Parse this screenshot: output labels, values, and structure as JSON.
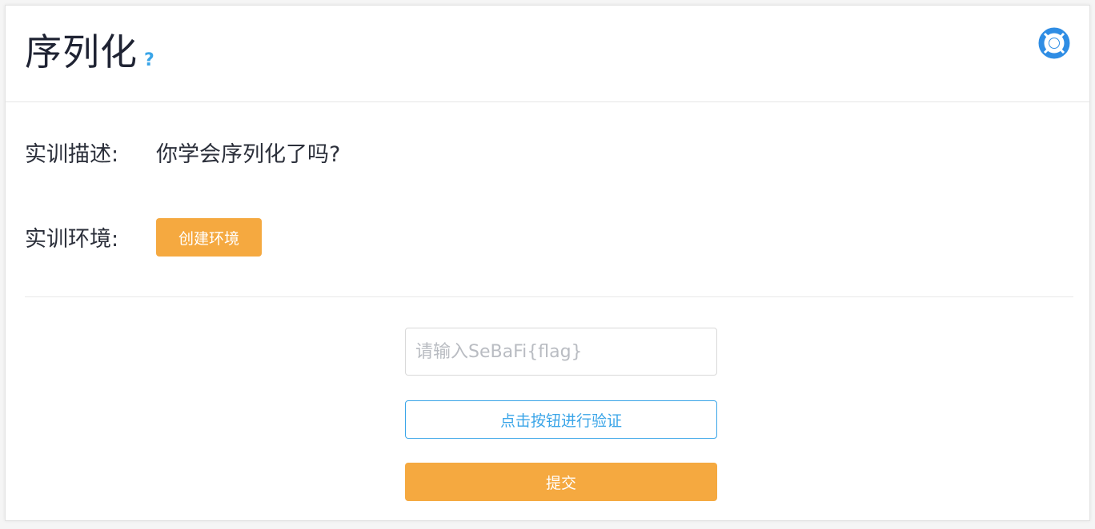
{
  "header": {
    "title": "序列化",
    "help_label": "?",
    "support_icon": "lifebuoy-icon",
    "accent_color": "#3aa5e8"
  },
  "description": {
    "label": "实训描述:",
    "value": "你学会序列化了吗?"
  },
  "environment": {
    "label": "实训环境:",
    "create_button": "创建环境",
    "button_color": "#f5a940"
  },
  "form": {
    "flag_placeholder": "请输入SeBaFi{flag}",
    "flag_value": "",
    "verify_button": "点击按钮进行验证",
    "submit_button": "提交"
  }
}
